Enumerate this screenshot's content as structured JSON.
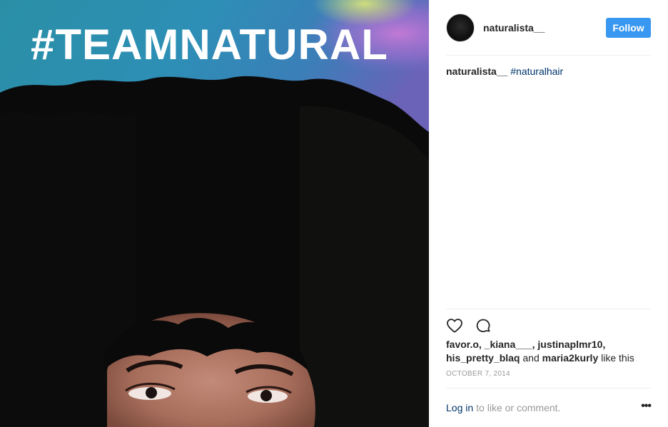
{
  "photo": {
    "caption": "#TEAMNATURAL"
  },
  "header": {
    "username": "naturalista__",
    "follow_label": "Follow"
  },
  "caption": {
    "author": "naturalista__",
    "hashtag": "#naturalhair"
  },
  "actions": {
    "like_icon": "heart-icon",
    "comment_icon": "comment-icon"
  },
  "likes": {
    "names_line1": "favor.o, _kiana___, justinaplmr10,",
    "names_line2": "his_pretty_blaq",
    "and_text": "and",
    "last_name": "maria2kurly",
    "suffix": "like this"
  },
  "date": "OCTOBER 7, 2014",
  "login": {
    "link_label": "Log in",
    "rest": "to like or comment.",
    "more_label": "•••"
  },
  "colors": {
    "accent": "#3897f0",
    "link": "#003569",
    "muted": "#999999"
  }
}
